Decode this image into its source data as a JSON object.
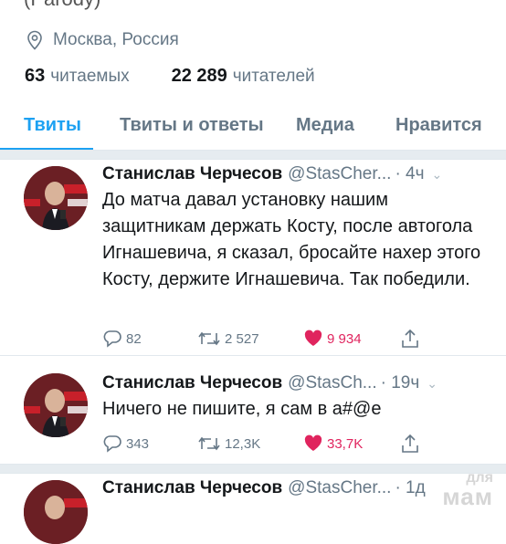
{
  "profile": {
    "top_text": "(Parody)",
    "location": "Москва, Россия",
    "following_count": "63",
    "following_label": "читаемых",
    "followers_count": "22 289",
    "followers_label": "читателей"
  },
  "tabs": [
    {
      "label": "Твиты"
    },
    {
      "label": "Твиты и ответы"
    },
    {
      "label": "Медиа"
    },
    {
      "label": "Нравится"
    }
  ],
  "tweets": [
    {
      "name": "Станислав Черчесов",
      "handle": "@StasCher...",
      "time": "· 4ч",
      "text": "До матча давал установку нашим защитникам держать Косту, после автогола Игнашевича, я сказал, бросайте нахер этого Косту, держите Игнашевича. Так победили.",
      "replies": "82",
      "retweets": "2 527",
      "likes": "9 934"
    },
    {
      "name": "Станислав Черчесов",
      "handle": "@StasCh...",
      "time": "· 19ч",
      "text": "Ничего не пишите, я сам в а#@е",
      "replies": "343",
      "retweets": "12,3K",
      "likes": "33,7K"
    },
    {
      "name": "Станислав Черчесов",
      "handle": "@StasCher...",
      "time": "· 1д"
    }
  ],
  "watermark": {
    "line1": "для",
    "line2": "мам"
  },
  "colors": {
    "accent": "#1da1f2",
    "like": "#e0245e",
    "muted": "#657786"
  }
}
